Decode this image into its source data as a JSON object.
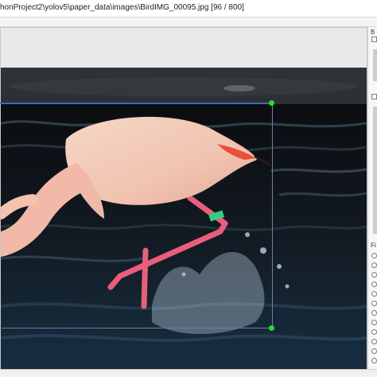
{
  "window": {
    "title": "honProject2\\yolov5\\paper_data\\images\\BirdIMG_00095.jpg [96 / 800]"
  },
  "right_panel": {
    "header_label": "B",
    "list_label": "Fi"
  },
  "colors": {
    "handle": "#22dd33",
    "bbox_border": "#4a64c2"
  },
  "annotation": {
    "subject": "flamingo"
  }
}
